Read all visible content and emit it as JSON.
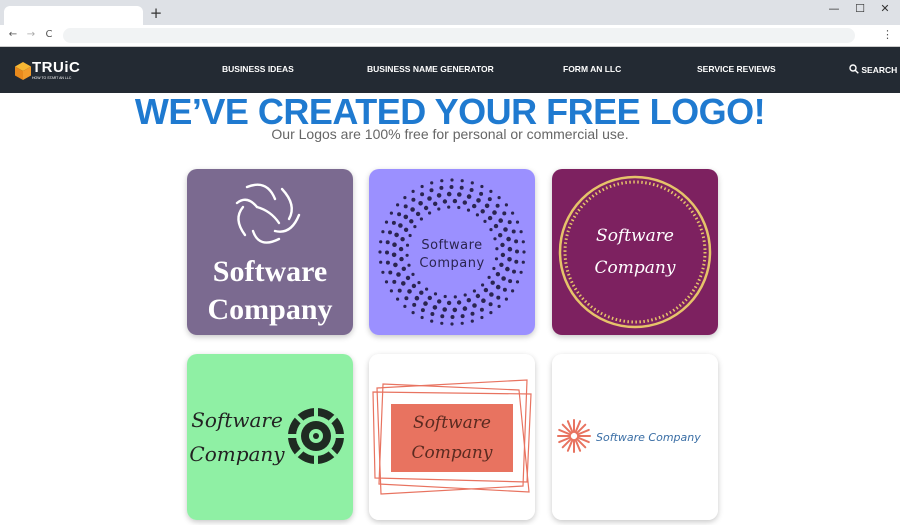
{
  "browser": {
    "new_tab_symbol": "+",
    "back_symbol": "←",
    "forward_symbol": "→",
    "reload_symbol": "C",
    "menu_symbol": "⋮",
    "minimize_symbol": "—",
    "maximize_symbol": "☐",
    "close_symbol": "✕"
  },
  "site": {
    "brand": "TRUiC",
    "brand_sub": "HOW TO START AN LLC",
    "nav": [
      "BUSINESS IDEAS",
      "BUSINESS NAME GENERATOR",
      "FORM AN LLC",
      "SERVICE REVIEWS"
    ],
    "search_label": "SEARCH"
  },
  "main": {
    "headline": "WE’VE CREATED YOUR FREE LOGO!",
    "subtitle": "Our Logos are 100% free for personal or commercial use."
  },
  "logos": [
    {
      "line1": "Software",
      "line2": "Company",
      "bg": "#7b6a90",
      "fg": "#ffffff"
    },
    {
      "line1": "Software",
      "line2": "Company",
      "bg": "#9b90ff",
      "fg": "#2a2450"
    },
    {
      "line1": "Software",
      "line2": "Company",
      "bg": "#7d2160",
      "fg": "#ffffff",
      "ring": "#e6c36a"
    },
    {
      "line1": "Software",
      "line2": "Company",
      "bg": "#8ff0a4",
      "fg": "#222222"
    },
    {
      "line1": "Software",
      "line2": "Company",
      "bg": "#ffffff",
      "box": "#e87360",
      "fg": "#5a2a20"
    },
    {
      "text": "Software Company",
      "bg": "#ffffff",
      "fg": "#3a6ea5",
      "accent": "#e87360"
    }
  ]
}
